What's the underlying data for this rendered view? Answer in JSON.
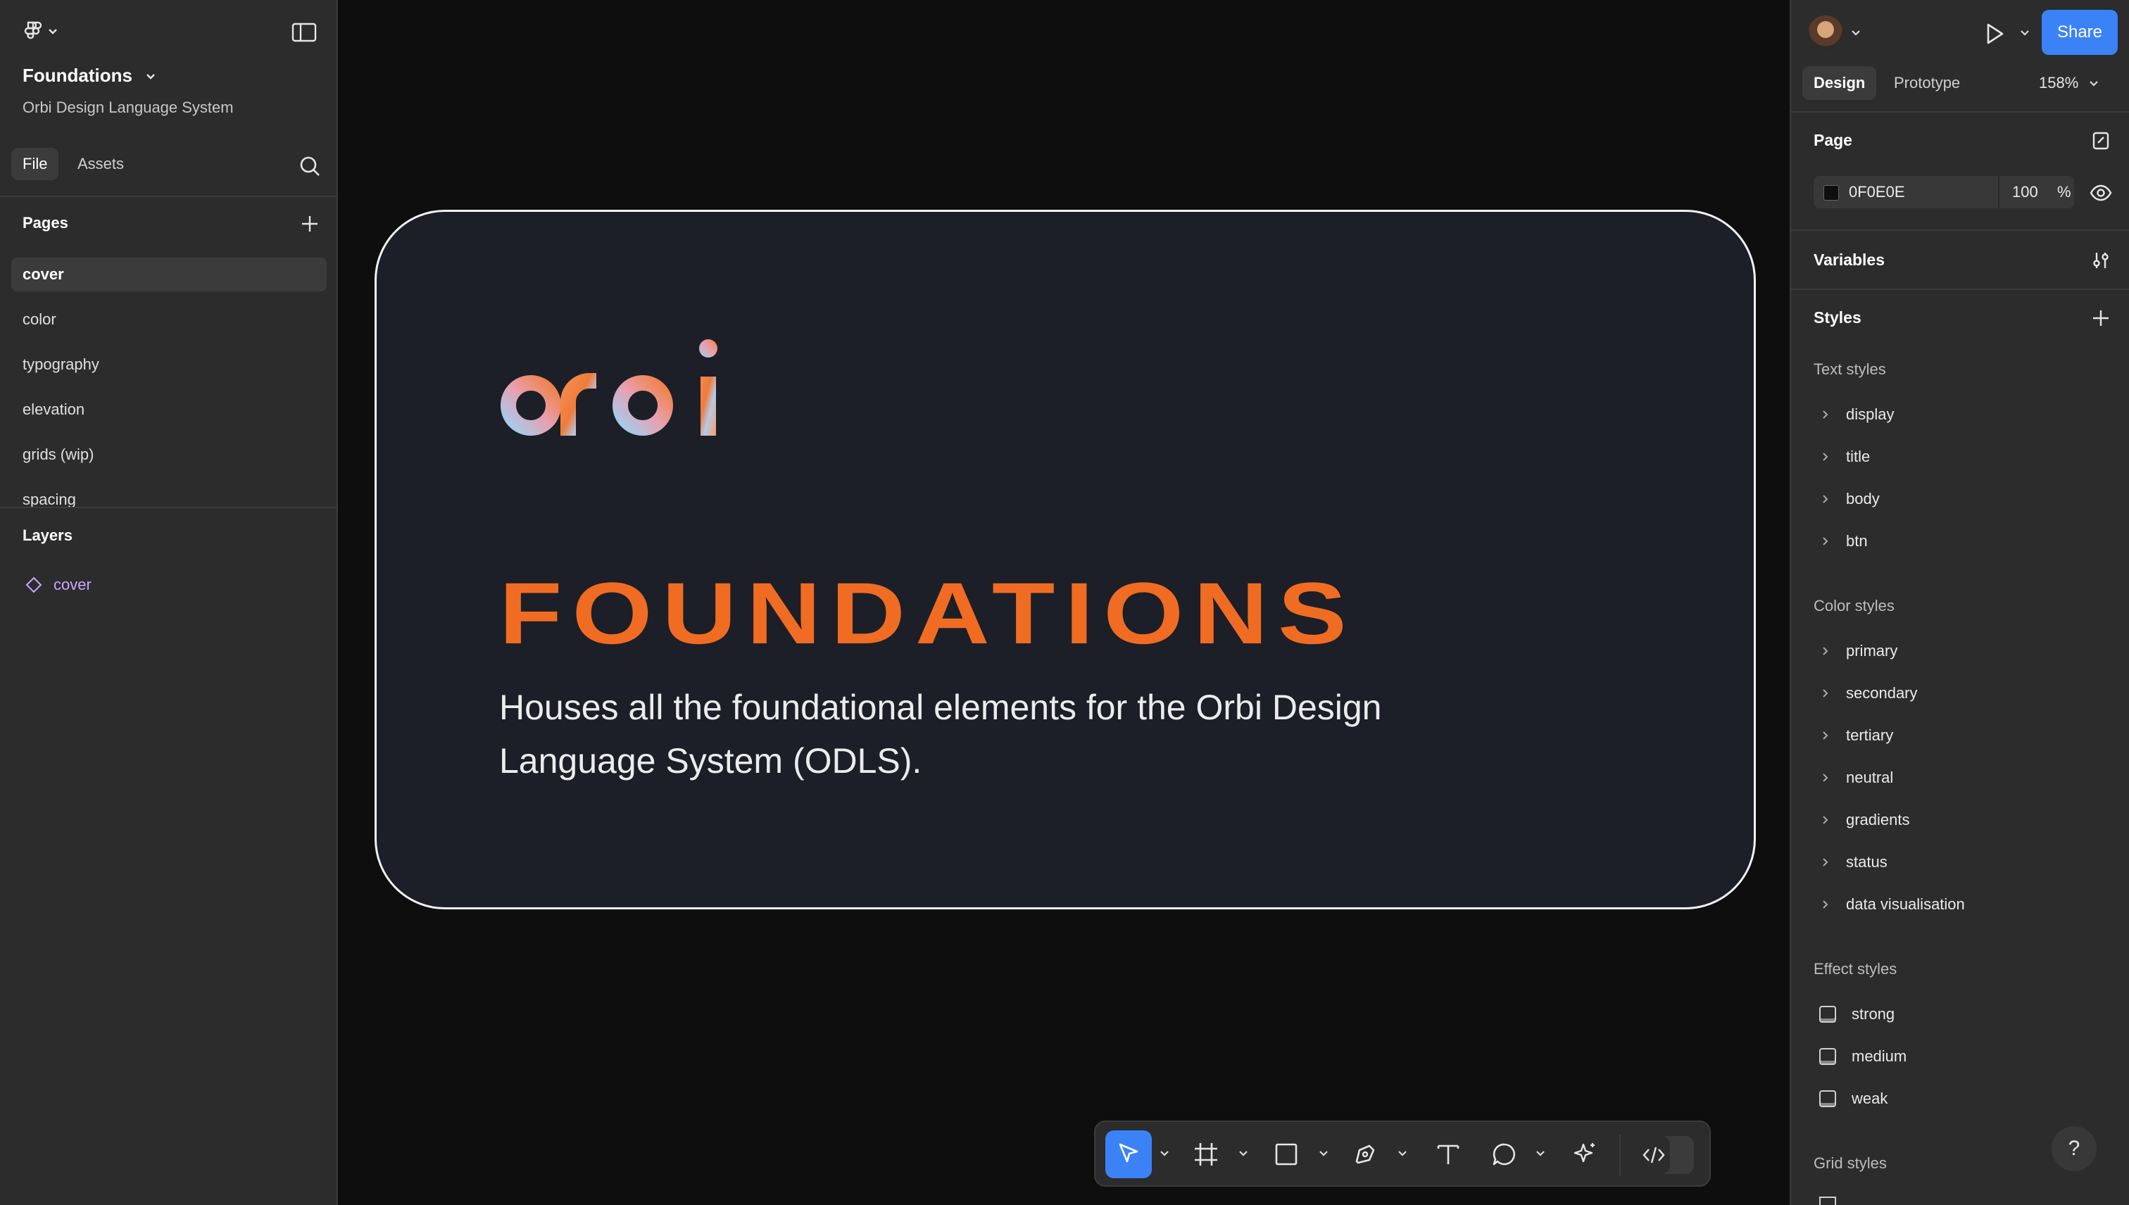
{
  "left_panel": {
    "file_title": "Foundations",
    "file_subtitle": "Orbi Design Language System",
    "tabs": [
      {
        "label": "File"
      },
      {
        "label": "Assets"
      }
    ],
    "pages_heading": "Pages",
    "pages": [
      {
        "label": "cover",
        "active": true
      },
      {
        "label": "color"
      },
      {
        "label": "typography"
      },
      {
        "label": "elevation"
      },
      {
        "label": "grids (wip)"
      },
      {
        "label": "spacing"
      }
    ],
    "layers_heading": "Layers",
    "layers": [
      {
        "label": "cover"
      }
    ]
  },
  "canvas": {
    "logo_text": "orbi",
    "title": "FOUNDATIONS",
    "description": "Houses all the foundational elements for the Orbi Design Language System (ODLS)."
  },
  "toolbar": {
    "tools": [
      "move-tool",
      "frame-tool",
      "rectangle-tool",
      "pen-tool",
      "text-tool",
      "comment-tool",
      "actions-tool"
    ],
    "active_tool": "move-tool"
  },
  "right_panel": {
    "share_label": "Share",
    "tabs": [
      {
        "label": "Design"
      },
      {
        "label": "Prototype"
      }
    ],
    "zoom": "158%",
    "page_heading": "Page",
    "page_color_hex": "0F0E0E",
    "page_opacity": "100",
    "page_opacity_unit": "%",
    "variables_heading": "Variables",
    "styles_heading": "Styles",
    "text_styles_heading": "Text styles",
    "text_styles": [
      "display",
      "title",
      "body",
      "btn"
    ],
    "color_styles_heading": "Color styles",
    "color_styles": [
      "primary",
      "secondary",
      "tertiary",
      "neutral",
      "gradients",
      "status",
      "data visualisation"
    ],
    "effect_styles_heading": "Effect styles",
    "effect_styles": [
      "strong",
      "medium",
      "weak"
    ],
    "grid_styles_heading": "Grid styles",
    "help_label": "?"
  },
  "colors": {
    "accent": "#3b82f6",
    "title_orange": "#f06c23",
    "canvas_bg": "#0f0e0e",
    "card_bg": "#1c1f27",
    "layer_purple": "#c9a6ff"
  }
}
